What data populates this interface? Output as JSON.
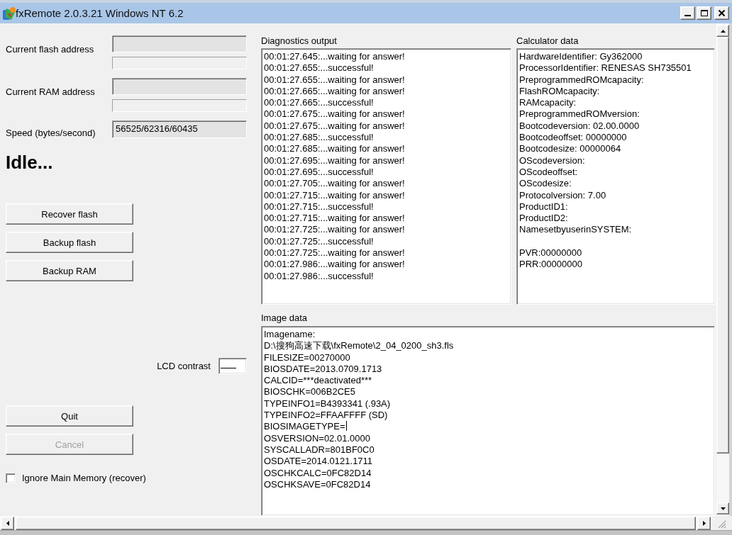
{
  "window": {
    "title": "fxRemote 2.0.3.21 Windows NT 6.2"
  },
  "address_rows": [
    {
      "label": "Current flash address",
      "field": {
        "disabled": true
      }
    },
    {
      "label": "Current RAM address",
      "field": {
        "disabled": true
      }
    }
  ],
  "speed": {
    "label": "Speed (bytes/second)",
    "value": "56525/62316/60435",
    "disabled": true
  },
  "status": "Idle...",
  "actions": [
    {
      "label": "Recover flash",
      "disabled": false
    },
    {
      "label": "Backup flash",
      "disabled": false
    },
    {
      "label": "Backup RAM",
      "disabled": false
    }
  ],
  "lcd_contrast": {
    "label": "LCD contrast"
  },
  "controls": [
    {
      "label": "Quit",
      "disabled": false
    },
    {
      "label": "Cancel",
      "disabled": true
    }
  ],
  "options": [
    {
      "label": "Ignore Main Memory (recover)",
      "checked": false
    }
  ],
  "diagnostics": {
    "label": "Diagnostics output",
    "lines": [
      "00:01:27.645:...waiting for answer!",
      "00:01:27.655:...successful!",
      "00:01:27.655:...waiting for answer!",
      "00:01:27.665:...waiting for answer!",
      "00:01:27.665:...successful!",
      "00:01:27.675:...waiting for answer!",
      "00:01:27.675:...waiting for answer!",
      "00:01:27.685:...successful!",
      "00:01:27.685:...waiting for answer!",
      "00:01:27.695:...waiting for answer!",
      "00:01:27.695:...successful!",
      "00:01:27.705:...waiting for answer!",
      "00:01:27.715:...waiting for answer!",
      "00:01:27.715:...successful!",
      "00:01:27.715:...waiting for answer!",
      "00:01:27.725:...waiting for answer!",
      "00:01:27.725:...successful!",
      "00:01:27.725:...waiting for answer!",
      "00:01:27.986:...waiting for answer!",
      "00:01:27.986:...successful!"
    ]
  },
  "calculator_data": {
    "label": "Calculator data",
    "lines": [
      "HardwareIdentifier: Gy362000",
      "ProcessorIdentifier: RENESAS SH735501",
      "PreprogrammedROMcapacity:",
      "FlashROMcapacity:",
      "RAMcapacity:",
      "PreprogrammedROMversion:",
      "Bootcodeversion: 02.00.0000",
      "Bootcodeoffset: 00000000",
      "Bootcodesize: 00000064",
      "OScodeversion:",
      "OScodeoffset:",
      "OScodesize:",
      "Protocolversion: 7.00",
      "ProductID1:",
      "ProductID2:",
      "NamesetbyuserinSYSTEM:"
    ],
    "registers": [
      "PVR:00000000",
      "PRR:00000000"
    ]
  },
  "image_data": {
    "label": "Image data",
    "lines": [
      {
        "text": "Imagename:",
        "cursor": false
      },
      {
        "text": "D:\\搜狗高速下载\\fxRemote\\2_04_0200_sh3.fls",
        "cursor": false
      },
      {
        "text": "FILESIZE=00270000",
        "cursor": false
      },
      {
        "text": "BIOSDATE=2013.0709.1713",
        "cursor": false
      },
      {
        "text": "CALCID=***deactivated***",
        "cursor": false
      },
      {
        "text": "BIOSCHK=006B2CE5",
        "cursor": false
      },
      {
        "text": "TYPEINFO1=B4393341 (.93A)",
        "cursor": false
      },
      {
        "text": "TYPEINFO2=FFAAFFFF (SD)",
        "cursor": false
      },
      {
        "text": "BIOSIMAGETYPE=",
        "cursor": true
      },
      {
        "text": "OSVERSION=02.01.0000",
        "cursor": false
      },
      {
        "text": "SYSCALLADR=801BF0C0",
        "cursor": false
      },
      {
        "text": "OSDATE=2014.0121.1711",
        "cursor": false
      },
      {
        "text": "OSCHKCALC=0FC82D14",
        "cursor": false
      },
      {
        "text": "OSCHKSAVE=0FC82D14",
        "cursor": false
      }
    ]
  }
}
